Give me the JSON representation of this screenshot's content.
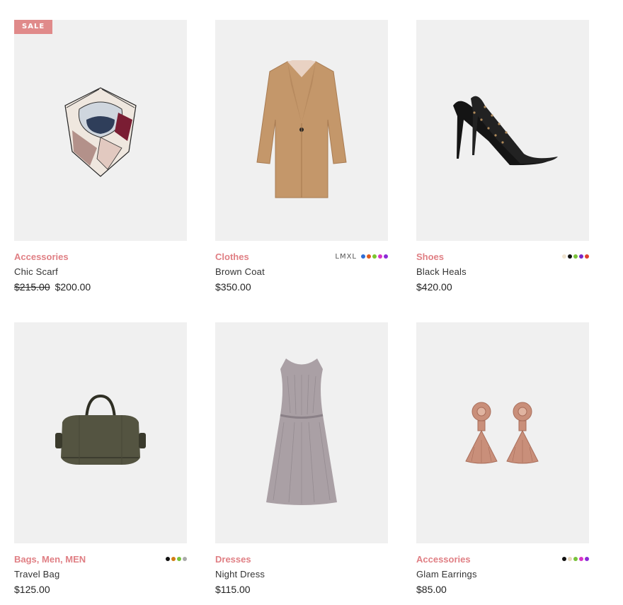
{
  "products": [
    {
      "badge": "SALE",
      "category": "Accessories",
      "name": "Chic Scarf",
      "price_old": "$215.00",
      "price": "$200.00",
      "image": "scarf-image",
      "sizes": "",
      "swatches": []
    },
    {
      "category": "Clothes",
      "name": "Brown Coat",
      "price": "$350.00",
      "image": "coat-image",
      "sizes": "LMXL",
      "swatches": [
        "#2f6fd6",
        "#e05a1e",
        "#7cc72e",
        "#d833c7",
        "#8c2bd6"
      ]
    },
    {
      "category": "Shoes",
      "name": "Black Heals",
      "price": "$420.00",
      "image": "heels-image",
      "sizes": "",
      "swatches": [
        "#efe3cf",
        "#111111",
        "#78c23a",
        "#7a26c9",
        "#e0402e"
      ]
    },
    {
      "category": "Bags, Men, MEN",
      "name": "Travel Bag",
      "price": "$125.00",
      "image": "travel-bag-image",
      "sizes": "",
      "swatches": [
        "#111111",
        "#d27d14",
        "#78c23a",
        "#aaaaaa"
      ]
    },
    {
      "category": "Dresses",
      "name": "Night Dress",
      "price": "$115.00",
      "image": "dress-image",
      "sizes": "",
      "swatches": []
    },
    {
      "category": "Accessories",
      "name": "Glam Earrings",
      "price": "$85.00",
      "image": "earrings-image",
      "sizes": "",
      "swatches": [
        "#111111",
        "#e8d7b8",
        "#78c23a",
        "#d833c7",
        "#8c2bd6"
      ]
    }
  ]
}
